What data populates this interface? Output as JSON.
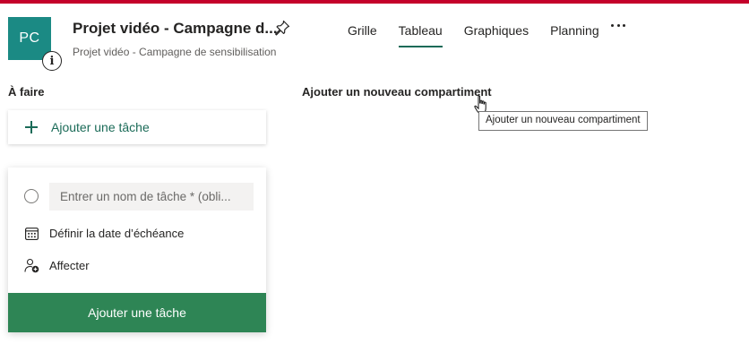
{
  "header": {
    "avatar_initials": "PC",
    "info_icon": "info-icon",
    "plan_title": "Projet vidéo - Campagne d...",
    "pin_icon": "pin-icon",
    "plan_subtitle": "Projet vidéo - Campagne de sensibilisation"
  },
  "tabs": [
    {
      "label": "Grille",
      "active": false
    },
    {
      "label": "Tableau",
      "active": true
    },
    {
      "label": "Graphiques",
      "active": false
    },
    {
      "label": "Planning",
      "active": false
    }
  ],
  "more_icon": "more-horizontal-icon",
  "bucket": {
    "title": "À faire",
    "add_task_label": "Ajouter une tâche"
  },
  "new_bucket_label": "Ajouter un nouveau compartiment",
  "new_task_form": {
    "name_placeholder": "Entrer un nom de tâche * (obli...",
    "name_value": "",
    "due_date_label": "Définir la date d’échéance",
    "assign_label": "Affecter",
    "submit_label": "Ajouter une tâche"
  },
  "tooltip_text": "Ajouter un nouveau compartiment",
  "colors": {
    "top_bar": "#c4002b",
    "avatar": "#1b8a84",
    "accent": "#1b6b58",
    "submit": "#2e8555"
  }
}
